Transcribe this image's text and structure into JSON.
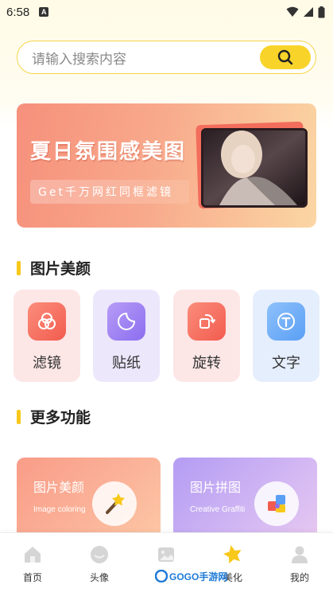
{
  "status_bar": {
    "time": "6:58",
    "notification_glyph": "A"
  },
  "search": {
    "placeholder": "请输入搜索内容"
  },
  "banner": {
    "title": "夏日氛围感美图",
    "subtitle": "Get千万网红同框滤镜"
  },
  "beauty_section": {
    "title": "图片美颜",
    "tools": [
      {
        "label": "滤镜",
        "icon": "filter-icon"
      },
      {
        "label": "贴纸",
        "icon": "sticker-icon"
      },
      {
        "label": "旋转",
        "icon": "rotate-icon"
      },
      {
        "label": "文字",
        "icon": "text-icon"
      }
    ]
  },
  "more_section": {
    "title": "更多功能",
    "cards": [
      {
        "title": "图片美颜",
        "subtitle": "Image coloring",
        "icon": "magic-wand-icon"
      },
      {
        "title": "图片拼图",
        "subtitle": "Creative Graffiti",
        "icon": "puzzle-icon"
      }
    ]
  },
  "bottom_nav": {
    "items": [
      {
        "label": "首页",
        "icon": "home-icon"
      },
      {
        "label": "头像",
        "icon": "avatar-icon"
      },
      {
        "label": "",
        "icon": "image-icon"
      },
      {
        "label": "美化",
        "icon": "star-icon",
        "active": true
      },
      {
        "label": "我的",
        "icon": "profile-icon"
      }
    ]
  },
  "watermark": {
    "text": "GOGO手游网"
  },
  "colors": {
    "accent": "#f8d42a",
    "banner_start": "#f6907c",
    "banner_end": "#fbd6a4"
  }
}
